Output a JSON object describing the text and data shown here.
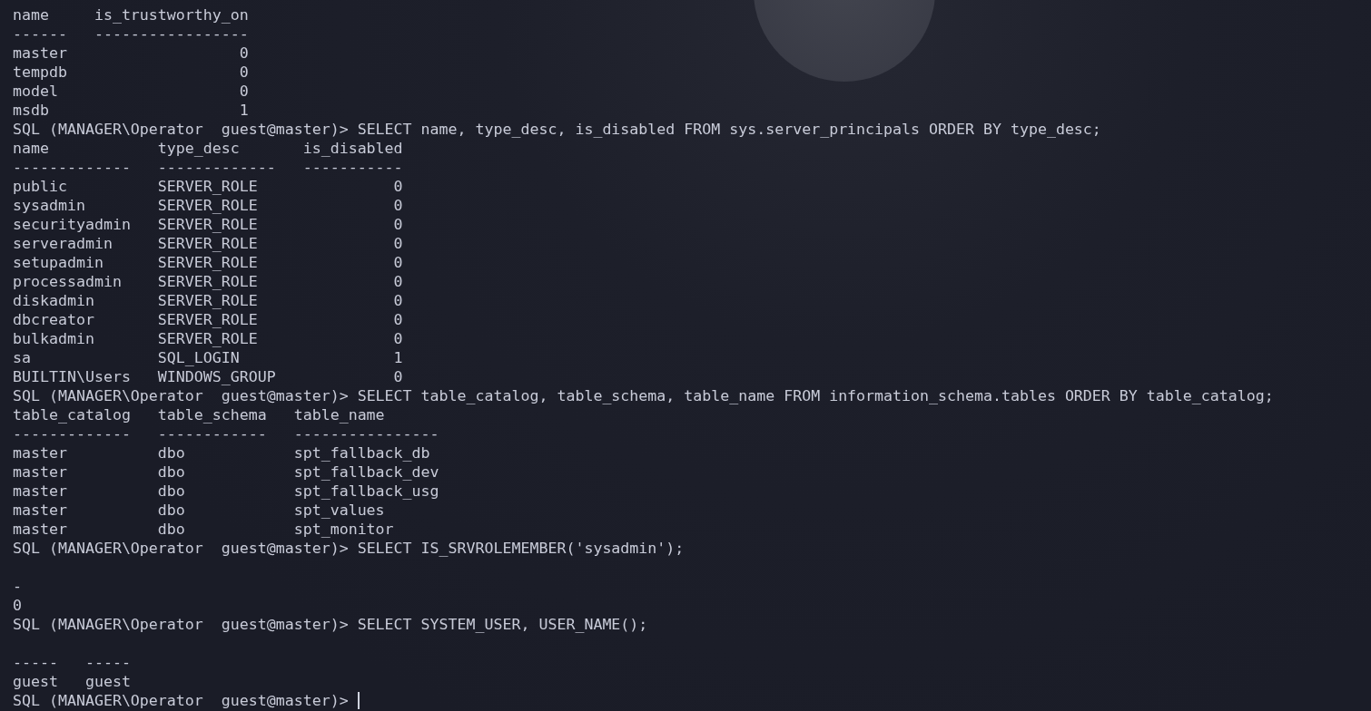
{
  "terminal": {
    "lines": [
      {
        "kind": "output",
        "text": "name     is_trustworthy_on"
      },
      {
        "kind": "output",
        "text": "------   -----------------"
      },
      {
        "kind": "output",
        "text": "master                   0"
      },
      {
        "kind": "output",
        "text": "tempdb                   0"
      },
      {
        "kind": "output",
        "text": "model                    0"
      },
      {
        "kind": "output",
        "text": "msdb                     1"
      },
      {
        "kind": "prompt",
        "prompt": "SQL (MANAGER\\Operator  guest@master)>",
        "command": "SELECT name, type_desc, is_disabled FROM sys.server_principals ORDER BY type_desc;",
        "cursor": false
      },
      {
        "kind": "output",
        "text": "name            type_desc       is_disabled"
      },
      {
        "kind": "output",
        "text": "-------------   -------------   -----------"
      },
      {
        "kind": "output",
        "text": "public          SERVER_ROLE               0"
      },
      {
        "kind": "output",
        "text": "sysadmin        SERVER_ROLE               0"
      },
      {
        "kind": "output",
        "text": "securityadmin   SERVER_ROLE               0"
      },
      {
        "kind": "output",
        "text": "serveradmin     SERVER_ROLE               0"
      },
      {
        "kind": "output",
        "text": "setupadmin      SERVER_ROLE               0"
      },
      {
        "kind": "output",
        "text": "processadmin    SERVER_ROLE               0"
      },
      {
        "kind": "output",
        "text": "diskadmin       SERVER_ROLE               0"
      },
      {
        "kind": "output",
        "text": "dbcreator       SERVER_ROLE               0"
      },
      {
        "kind": "output",
        "text": "bulkadmin       SERVER_ROLE               0"
      },
      {
        "kind": "output",
        "text": "sa              SQL_LOGIN                 1"
      },
      {
        "kind": "output",
        "text": "BUILTIN\\Users   WINDOWS_GROUP             0"
      },
      {
        "kind": "prompt",
        "prompt": "SQL (MANAGER\\Operator  guest@master)>",
        "command": "SELECT table_catalog, table_schema, table_name FROM information_schema.tables ORDER BY table_catalog;",
        "cursor": false
      },
      {
        "kind": "output",
        "text": "table_catalog   table_schema   table_name"
      },
      {
        "kind": "output",
        "text": "-------------   ------------   ----------------"
      },
      {
        "kind": "output",
        "text": "master          dbo            spt_fallback_db"
      },
      {
        "kind": "output",
        "text": "master          dbo            spt_fallback_dev"
      },
      {
        "kind": "output",
        "text": "master          dbo            spt_fallback_usg"
      },
      {
        "kind": "output",
        "text": "master          dbo            spt_values"
      },
      {
        "kind": "output",
        "text": "master          dbo            spt_monitor"
      },
      {
        "kind": "prompt",
        "prompt": "SQL (MANAGER\\Operator  guest@master)>",
        "command": "SELECT IS_SRVROLEMEMBER('sysadmin');",
        "cursor": false
      },
      {
        "kind": "blank"
      },
      {
        "kind": "output",
        "text": "-"
      },
      {
        "kind": "output",
        "text": "0"
      },
      {
        "kind": "prompt",
        "prompt": "SQL (MANAGER\\Operator  guest@master)>",
        "command": "SELECT SYSTEM_USER, USER_NAME();",
        "cursor": false
      },
      {
        "kind": "blank"
      },
      {
        "kind": "output",
        "text": "-----   -----"
      },
      {
        "kind": "output",
        "text": "guest   guest"
      },
      {
        "kind": "prompt",
        "prompt": "SQL (MANAGER\\Operator  guest@master)>",
        "cursor": true
      }
    ]
  }
}
